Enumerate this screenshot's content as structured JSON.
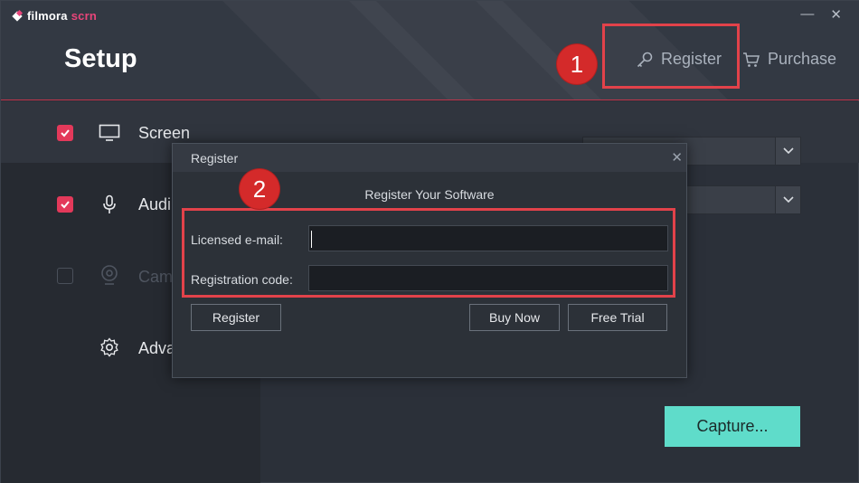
{
  "app": {
    "logo_main": "filmora",
    "logo_accent": "scrn",
    "minimize_glyph": "—",
    "close_glyph": "✕"
  },
  "header": {
    "title": "Setup",
    "register_label": "Register",
    "purchase_label": "Purchase",
    "register_icon": "key-icon",
    "purchase_icon": "cart-icon"
  },
  "annotations": [
    {
      "number": "1"
    },
    {
      "number": "2"
    }
  ],
  "options": [
    {
      "label": "Screen",
      "checked": true,
      "icon": "monitor-icon"
    },
    {
      "label": "Audi",
      "checked": true,
      "icon": "microphone-icon"
    },
    {
      "label": "Cam",
      "checked": false,
      "icon": "webcam-icon"
    },
    {
      "label": "Adva",
      "checked": null,
      "icon": "gear-icon"
    }
  ],
  "capture": {
    "label": "Capture..."
  },
  "dialog": {
    "title": "Register",
    "heading": "Register Your Software",
    "email_label": "Licensed e-mail:",
    "email_value": "",
    "code_label": "Registration code:",
    "code_value": "",
    "register_button": "Register",
    "buy_button": "Buy Now",
    "trial_button": "Free Trial",
    "close_glyph": "✕"
  },
  "colors": {
    "accent_pink": "#e3395a",
    "capture_teal": "#5fdcca",
    "annotation_red": "#d42a2a"
  }
}
